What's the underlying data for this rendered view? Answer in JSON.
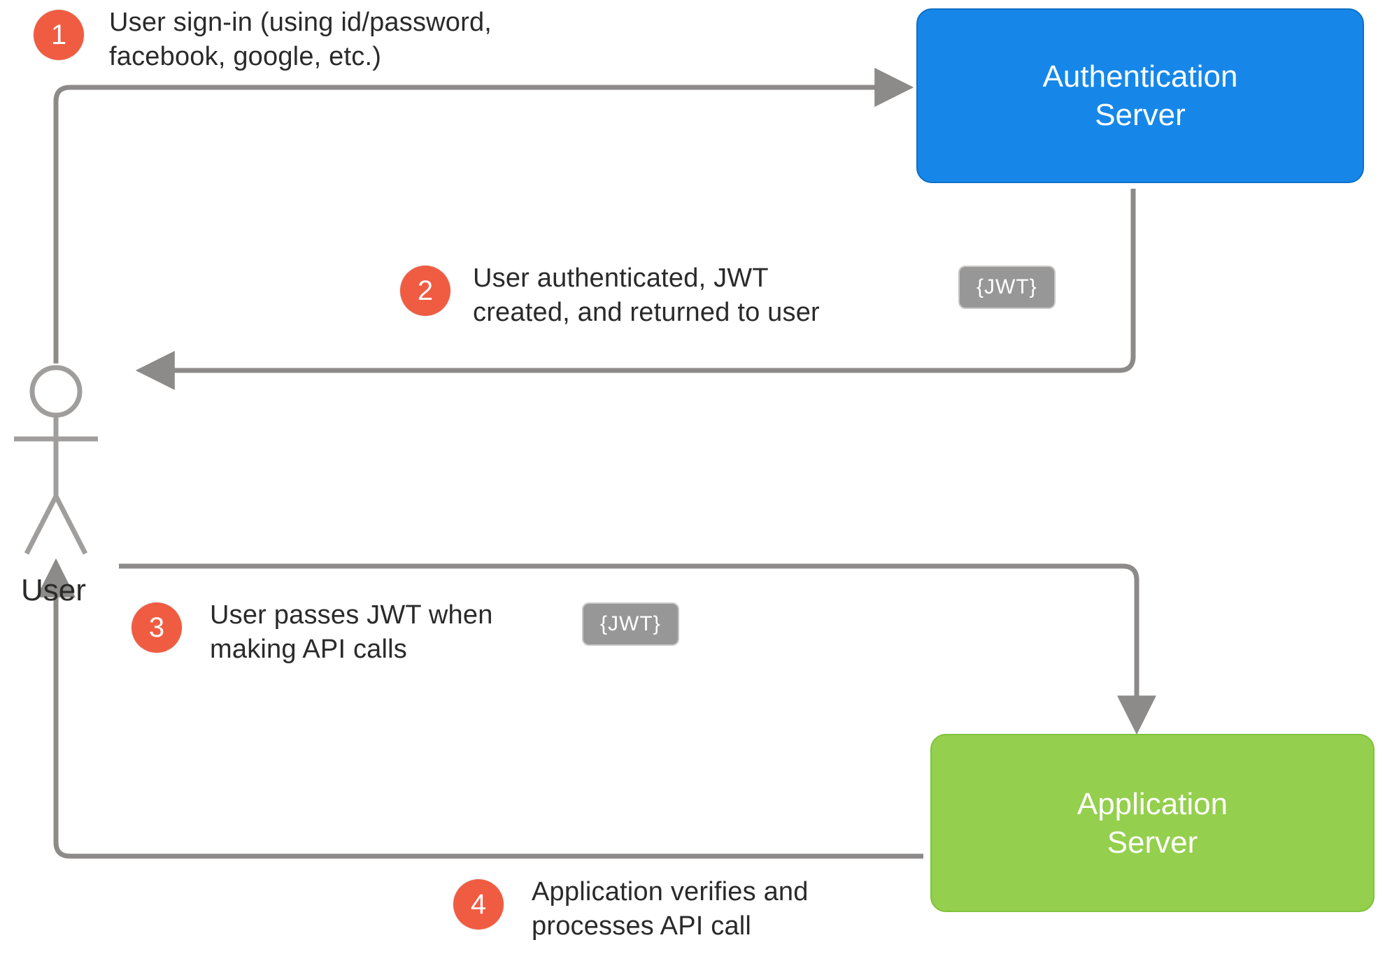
{
  "actors": {
    "user_label": "User"
  },
  "nodes": {
    "auth_server_label": "Authentication\nServer",
    "app_server_label": "Application\nServer"
  },
  "tokens": {
    "jwt_chip": "{JWT}"
  },
  "steps": [
    {
      "num": "1",
      "text": "User sign-in (using id/password,\nfacebook, google, etc.)"
    },
    {
      "num": "2",
      "text": "User authenticated, JWT\ncreated, and returned to user"
    },
    {
      "num": "3",
      "text": "User passes JWT when\nmaking API calls"
    },
    {
      "num": "4",
      "text": "Application verifies and\nprocesses API call"
    }
  ],
  "colors": {
    "badge": "#f05c42",
    "auth_server": "#1687e9",
    "app_server": "#94cf4d",
    "arrow": "#8c8b89",
    "chip": "#989797"
  }
}
